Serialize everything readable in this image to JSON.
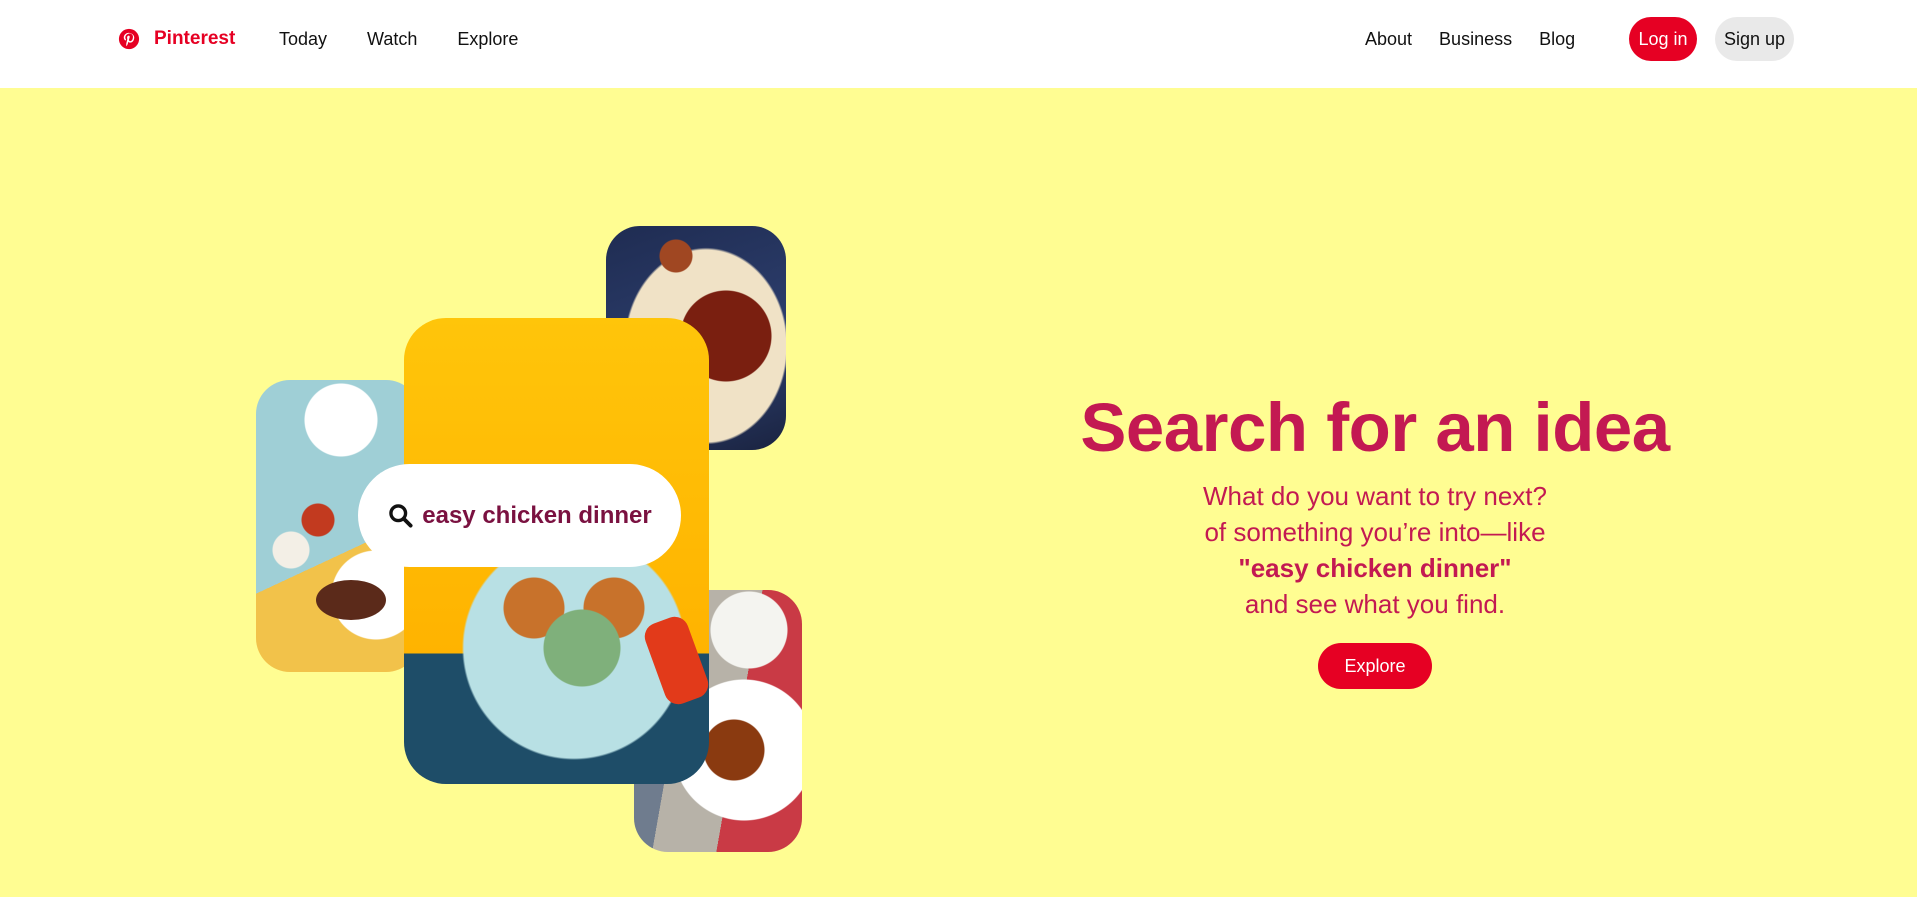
{
  "header": {
    "brand_name": "Pinterest",
    "nav_left": [
      "Today",
      "Watch",
      "Explore"
    ],
    "nav_right": [
      "About",
      "Business",
      "Blog"
    ],
    "login_label": "Log in",
    "signup_label": "Sign up"
  },
  "hero": {
    "search_query": "easy chicken dinner",
    "title": "Search for an idea",
    "line1": "What do you want to try next?",
    "line2": "of something you’re into—like",
    "line3": "\"easy chicken dinner\"",
    "line4": "and see what you find.",
    "explore_label": "Explore"
  },
  "colors": {
    "brand_red": "#e60023",
    "hero_background": "#fffd92",
    "hero_text": "#c31952",
    "search_text": "#7a1140"
  },
  "icons": {
    "brand": "pinterest-logo-icon",
    "search": "search-icon"
  }
}
